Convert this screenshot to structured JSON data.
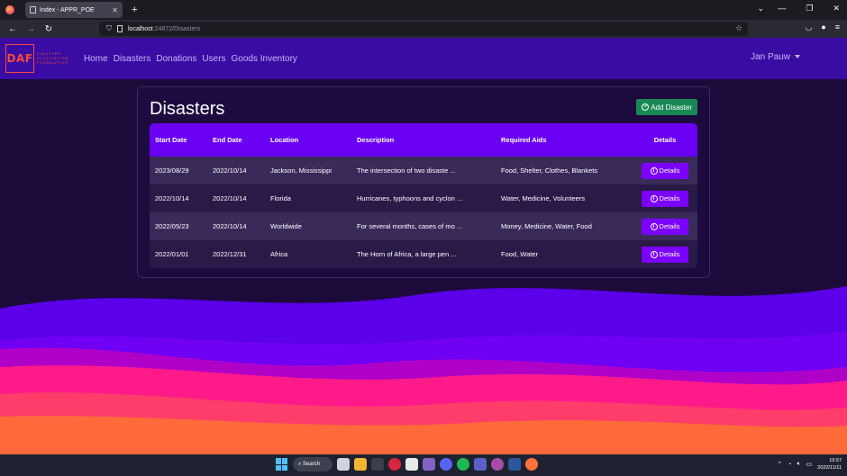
{
  "browser": {
    "tab_title": "Index - APPR_POE",
    "url_host": "localhost",
    "url_rest": ":24872/Disasters"
  },
  "app": {
    "logo_letters": "DAF",
    "logo_text": "DISASTER ALLEVIATION FOUNDATION",
    "menu": [
      "Home",
      "Disasters",
      "Donations",
      "Users",
      "Goods Inventory"
    ],
    "user": "Jan Pauw"
  },
  "page": {
    "title": "Disasters",
    "add_button": "Add Disaster",
    "columns": [
      "Start Date",
      "End Date",
      "Location",
      "Description",
      "Required Aids",
      "Details"
    ],
    "rows": [
      {
        "start": "2023/08/29",
        "end": "2022/10/14",
        "location": "Jackson, Mississippi",
        "description": "The intersection of two disaste ...",
        "aids": "Food, Shelter, Clothes, Blankets",
        "details": "Details"
      },
      {
        "start": "2022/10/14",
        "end": "2022/10/14",
        "location": "Florida",
        "description": "Hurricanes, typhoons and cyclon ...",
        "aids": "Water, Medicine, Volunteers",
        "details": "Details"
      },
      {
        "start": "2022/05/23",
        "end": "2022/10/14",
        "location": "Worldwide",
        "description": "For several months, cases of mo ...",
        "aids": "Money, Medicine, Water, Food",
        "details": "Details"
      },
      {
        "start": "2022/01/01",
        "end": "2022/12/31",
        "location": "Africa",
        "description": "The Horn of Africa, a large pen ...",
        "aids": "Food, Water",
        "details": "Details"
      }
    ]
  },
  "taskbar": {
    "search": "Search",
    "time": "19:57",
    "date": "2022/11/11"
  },
  "colors": {
    "navbar": "#3a0ca3",
    "table_header": "#6a00f4",
    "details_button": "#7b00ff",
    "add_button": "#198754"
  }
}
